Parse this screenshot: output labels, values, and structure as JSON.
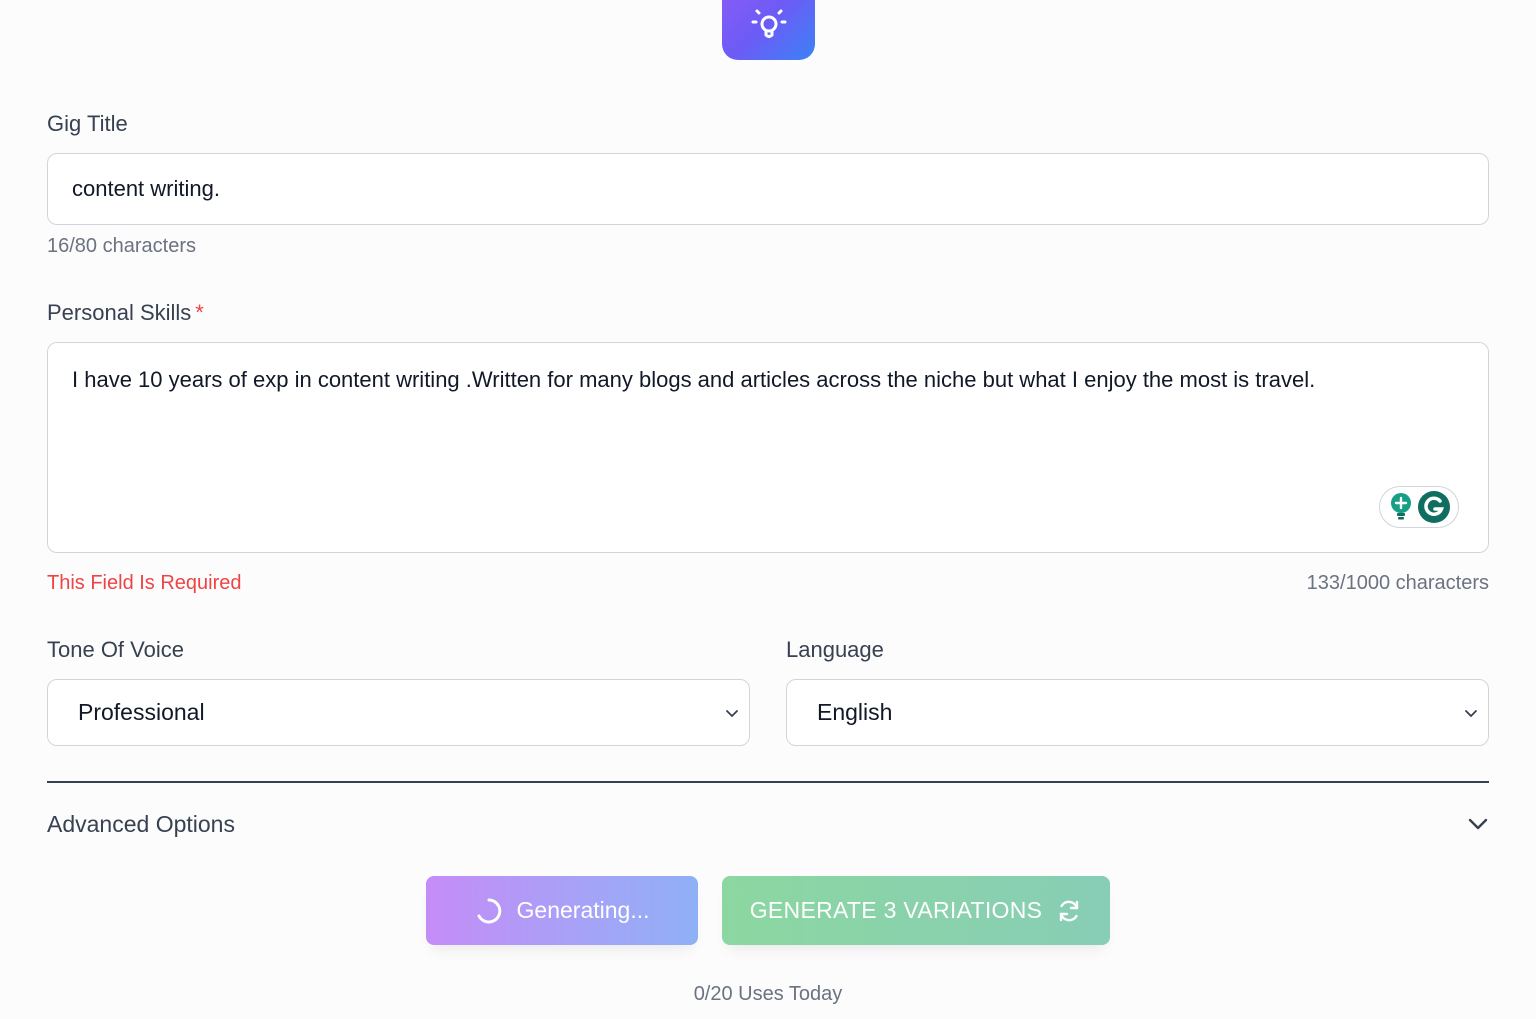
{
  "logo": {
    "icon": "lightbulb-icon"
  },
  "gig_title": {
    "label": "Gig Title",
    "value": "content writing.",
    "counter": "16/80 characters"
  },
  "personal_skills": {
    "label": "Personal Skills",
    "required_mark": "*",
    "value": "I have 10 years of exp in content writing .Written for many blogs and articles across the niche but what I enjoy the most is travel.",
    "error": "This Field Is Required",
    "counter": "133/1000 characters"
  },
  "tone": {
    "label": "Tone Of Voice",
    "selected": "Professional"
  },
  "language": {
    "label": "Language",
    "selected": "English"
  },
  "advanced": {
    "label": "Advanced Options"
  },
  "buttons": {
    "generating": "Generating...",
    "variations": "GENERATE 3 VARIATIONS"
  },
  "usage": "0/20 Uses Today",
  "colors": {
    "error": "#ef4444",
    "grammarly_green": "#15a085",
    "grammarly_dark": "#0f6e5f"
  }
}
